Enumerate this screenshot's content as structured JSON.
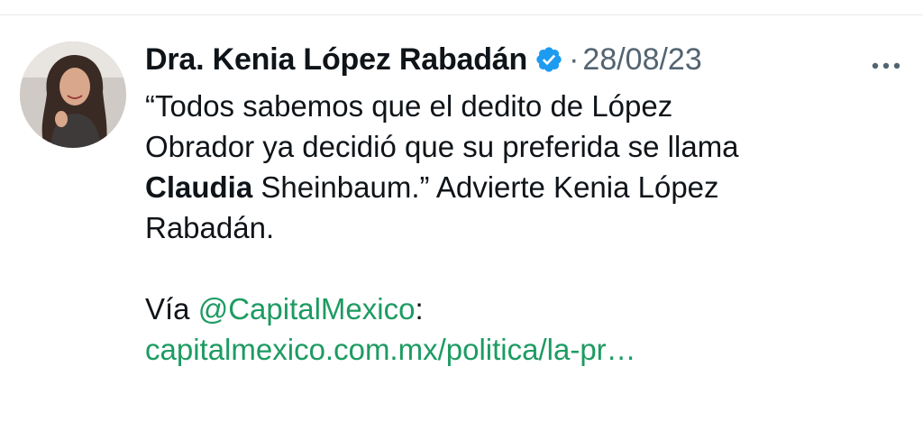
{
  "tweet": {
    "author": {
      "name": "Dra. Kenia López Rabadán",
      "verified": true,
      "avatar": "avatar-photo"
    },
    "separator": "·",
    "timestamp": "28/08/23",
    "more_icon": "more-horizontal-icon",
    "text": {
      "line1": "“Todos sabemos que el dedito de López",
      "line2": "Obrador ya decidió que su preferida se llama",
      "line3_bold": "Claudia",
      "line3_rest": " Sheinbaum.” Advierte Kenia López",
      "line4": "Rabadán.",
      "via_prefix": "Vía ",
      "mention": "@CapitalMexico",
      "via_suffix": ":",
      "url": "capitalmexico.com.mx/politica/la-pr…"
    },
    "colors": {
      "link": "#1d9b62",
      "verified": "#1d9bf0",
      "secondary": "#536471",
      "text": "#0f1419"
    }
  }
}
